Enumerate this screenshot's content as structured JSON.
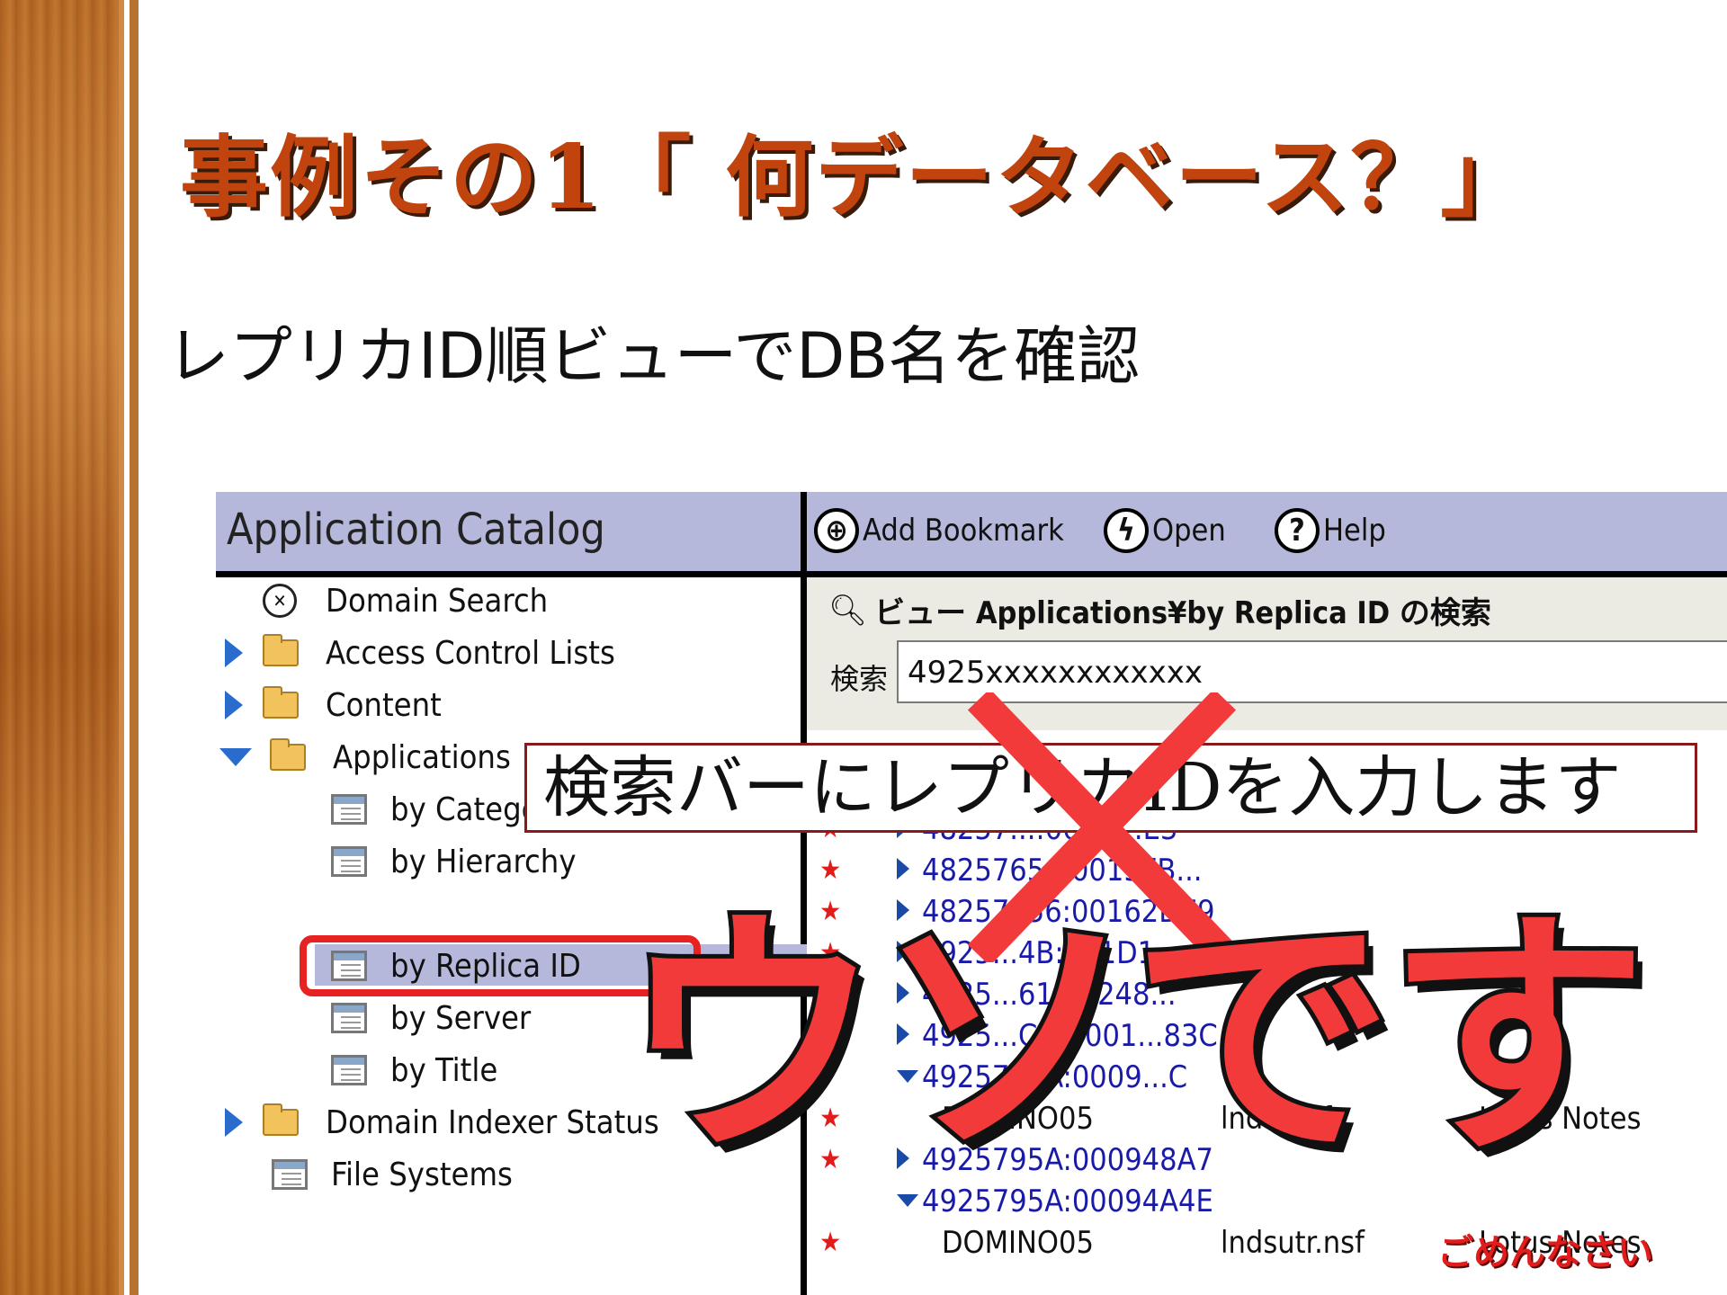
{
  "slide": {
    "title": "事例その1「 何データベース？」",
    "subtitle": "レプリカID順ビューでDB名を確認"
  },
  "catalog": {
    "title": "Application Catalog",
    "nav": [
      {
        "label": "Domain Search",
        "icon": "domain-search-icon"
      },
      {
        "label": "Access Control Lists",
        "icon": "folder-icon",
        "twisty": "collapsed"
      },
      {
        "label": "Content",
        "icon": "folder-icon",
        "twisty": "collapsed"
      },
      {
        "label": "Applications",
        "icon": "folder-open-icon",
        "twisty": "expanded"
      },
      {
        "label": "by Category",
        "icon": "view-icon"
      },
      {
        "label": "by Hierarchy",
        "icon": "view-icon"
      },
      {
        "label": "by Replica ID",
        "icon": "view-icon",
        "selected": true
      },
      {
        "label": "by Server",
        "icon": "view-icon"
      },
      {
        "label": "by Title",
        "icon": "view-icon"
      },
      {
        "label": "Domain Indexer Status",
        "icon": "folder-icon",
        "twisty": "collapsed"
      },
      {
        "label": "File Systems",
        "icon": "view-icon"
      }
    ]
  },
  "toolbar": {
    "add_bookmark": "Add Bookmark",
    "open": "Open",
    "help": "Help"
  },
  "search": {
    "title": "ビュー Applications¥by Replica ID の検索",
    "label": "検索",
    "value": "4925xxxxxxxxxxxx"
  },
  "rows": [
    {
      "kind": "id",
      "text": "48257656:0015FB..."
    },
    {
      "kind": "id",
      "text": "48257656:00162DE9"
    },
    {
      "kind": "id",
      "text": "4925...4B:001D1..."
    },
    {
      "kind": "id",
      "text": "4925...61:00248..."
    },
    {
      "kind": "id",
      "text": "4925...CCB:001...83C"
    },
    {
      "kind": "id-open",
      "text": "4925795A:0009...C"
    },
    {
      "kind": "doc",
      "server": "DOMINO05",
      "file": "lndfr.nsf",
      "type": "Lotus Notes"
    },
    {
      "kind": "id",
      "text": "4925795A:000948A7"
    },
    {
      "kind": "id-open",
      "text": "4925795A:00094A4E"
    },
    {
      "kind": "doc",
      "server": "DOMINO05",
      "file": "lndsutr.nsf",
      "type": "Lotus Notes"
    }
  ],
  "row_top": {
    "id": "48257...:000C...E3"
  },
  "overlay": {
    "callout": "検索バーにレプリカIDを入力します",
    "uso": "ウソです",
    "gomen": "ごめんなさい"
  },
  "colors": {
    "title": "#c1440e",
    "accent_red": "#f23a3a",
    "header_bg": "#b5b8da"
  }
}
